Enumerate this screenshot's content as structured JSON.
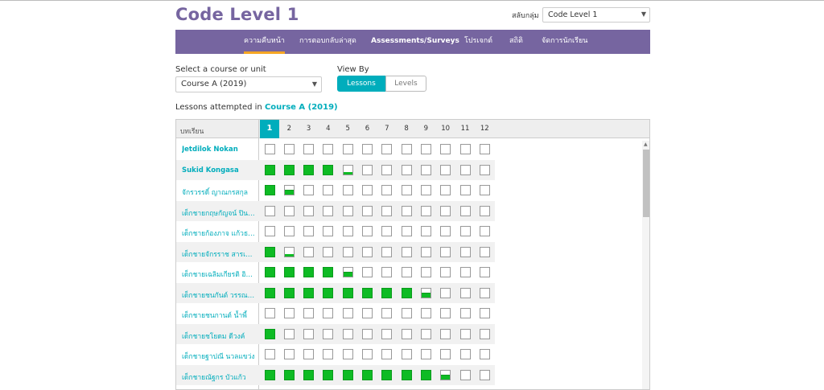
{
  "header": {
    "title": "Code Level 1",
    "section_label": "สลับกลุ่ม",
    "section_value": "Code Level 1"
  },
  "nav": {
    "items": [
      {
        "label": "ความคืบหน้า",
        "active": true
      },
      {
        "label": "การตอบกลับล่าสุด",
        "active": false
      },
      {
        "label": "Assessments/Surveys",
        "active": false
      },
      {
        "label": "โปรเจกต์",
        "active": false
      },
      {
        "label": "สถิติ",
        "active": false
      },
      {
        "label": "จัดการนักเรียน",
        "active": false
      }
    ]
  },
  "controls": {
    "course_label": "Select a course or unit",
    "course_value": "Course A (2019)",
    "view_by_label": "View By",
    "view_options": [
      "Lessons",
      "Levels"
    ],
    "selected_view": "Lessons"
  },
  "progress": {
    "heading_prefix": "Lessons attempted in",
    "heading_course": "Course A (2019)",
    "name_column_header": "บทเรียน",
    "lesson_columns": [
      "1",
      "2",
      "3",
      "4",
      "5",
      "6",
      "7",
      "8",
      "9",
      "10",
      "11",
      "12"
    ],
    "active_column": "1",
    "students": [
      {
        "name": "Jetdilok Nokan",
        "bold": true,
        "cells": [
          "e",
          "e",
          "e",
          "e",
          "e",
          "e",
          "e",
          "e",
          "e",
          "e",
          "e",
          "e"
        ]
      },
      {
        "name": "Sukid Kongasa",
        "bold": true,
        "cells": [
          "d",
          "d",
          "d",
          "d",
          "h",
          "e",
          "e",
          "e",
          "e",
          "e",
          "e",
          "e"
        ]
      },
      {
        "name": "จักรวรรดิ์ ญาณกรสกุล",
        "bold": false,
        "cells": [
          "d",
          "p",
          "e",
          "e",
          "e",
          "e",
          "e",
          "e",
          "e",
          "e",
          "e",
          "e"
        ]
      },
      {
        "name": "เด็กชายกฤษกัญจน์ ปินคำ",
        "bold": false,
        "cells": [
          "e",
          "e",
          "e",
          "e",
          "e",
          "e",
          "e",
          "e",
          "e",
          "e",
          "e",
          "e"
        ]
      },
      {
        "name": "เด็กชายก้องภาจ แก้วธรรม",
        "bold": false,
        "cells": [
          "e",
          "e",
          "e",
          "e",
          "e",
          "e",
          "e",
          "e",
          "e",
          "e",
          "e",
          "e"
        ]
      },
      {
        "name": "เด็กชายจักรราช สารเถื่อ...",
        "bold": false,
        "cells": [
          "d",
          "h",
          "e",
          "e",
          "e",
          "e",
          "e",
          "e",
          "e",
          "e",
          "e",
          "e"
        ]
      },
      {
        "name": "เด็กชายเฉลิมเกียรติ อิน...",
        "bold": false,
        "cells": [
          "d",
          "d",
          "d",
          "d",
          "p",
          "e",
          "e",
          "e",
          "e",
          "e",
          "e",
          "e"
        ]
      },
      {
        "name": "เด็กชายชนกันต์ วรรณโน",
        "bold": false,
        "cells": [
          "d",
          "d",
          "d",
          "d",
          "d",
          "d",
          "d",
          "d",
          "p",
          "e",
          "e",
          "e"
        ]
      },
      {
        "name": "เด็กชายชนกานต์ น้ำพี้",
        "bold": false,
        "cells": [
          "e",
          "e",
          "e",
          "e",
          "e",
          "e",
          "e",
          "e",
          "e",
          "e",
          "e",
          "e"
        ]
      },
      {
        "name": "เด็กชายชโยดม ดีวงค์",
        "bold": false,
        "cells": [
          "d",
          "e",
          "e",
          "e",
          "e",
          "e",
          "e",
          "e",
          "e",
          "e",
          "e",
          "e"
        ]
      },
      {
        "name": "เด็กชายฐาปณี นวลแขว่ง",
        "bold": false,
        "cells": [
          "e",
          "e",
          "e",
          "e",
          "e",
          "e",
          "e",
          "e",
          "e",
          "e",
          "e",
          "e"
        ]
      },
      {
        "name": "เด็กชายณัฐกร บัวแก้ว",
        "bold": false,
        "cells": [
          "d",
          "d",
          "d",
          "d",
          "d",
          "d",
          "d",
          "d",
          "d",
          "p",
          "e",
          "e"
        ]
      },
      {
        "name": "",
        "bold": false,
        "cells": [
          "e",
          "e",
          "e",
          "e",
          "e",
          "e",
          "e",
          "e",
          "e",
          "e",
          "e",
          "e"
        ]
      }
    ]
  },
  "colors": {
    "brand_purple": "#7665a0",
    "accent_teal": "#00adbc",
    "complete_green": "#0ebb24",
    "active_tab_underline": "#f5a623"
  }
}
